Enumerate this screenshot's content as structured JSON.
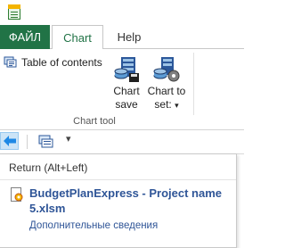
{
  "window": {
    "app_icon": "workbook-icon"
  },
  "tabs": {
    "file": "ФАЙЛ",
    "chart": "Chart",
    "help": "Help"
  },
  "ribbon": {
    "toc_label": "Table of contents",
    "chart_save_line1": "Chart",
    "chart_save_line2": "save",
    "chart_to_line1": "Chart to",
    "chart_to_line2": "set:",
    "chart_to_arrow": "▾",
    "group_label": "Chart tool"
  },
  "qat": {
    "back_icon": "arrow-left-icon",
    "item_icon": "table-of-contents-icon",
    "dropdown": "▾"
  },
  "tooltip": {
    "title": "Return (Alt+Left)",
    "file_name": "BudgetPlanExpress - Project name 5.xlsm",
    "more_link": "Дополнительные сведения"
  },
  "colors": {
    "excel_green": "#217346",
    "link_blue": "#2f5597",
    "hover_blue": "#cce4f7"
  }
}
